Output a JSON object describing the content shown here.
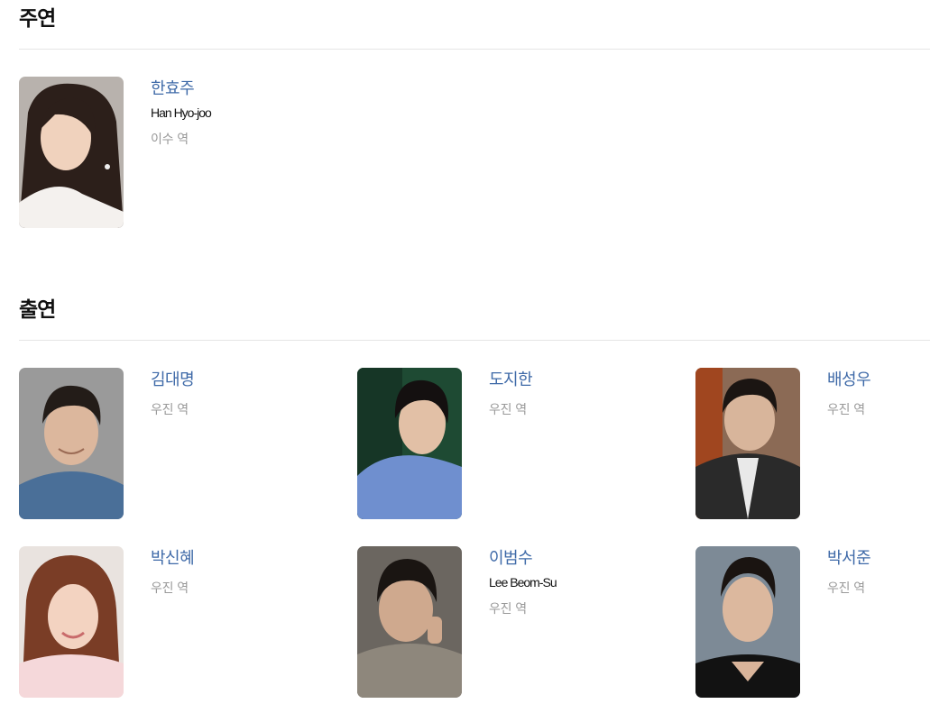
{
  "sections": {
    "lead": {
      "title": "주연",
      "cast": [
        {
          "name_ko": "한효주",
          "name_en": "Han Hyo-joo",
          "role": "이수 역",
          "photo": "portrait-han-hyo-joo"
        }
      ]
    },
    "supporting": {
      "title": "출연",
      "cast": [
        {
          "name_ko": "김대명",
          "role": "우진 역",
          "photo": "portrait-kim-dae-myung"
        },
        {
          "name_ko": "도지한",
          "role": "우진 역",
          "photo": "portrait-do-ji-han"
        },
        {
          "name_ko": "배성우",
          "role": "우진 역",
          "photo": "portrait-bae-sung-woo"
        },
        {
          "name_ko": "박신혜",
          "role": "우진 역",
          "photo": "portrait-park-shin-hye"
        },
        {
          "name_ko": "이범수",
          "name_en": "Lee Beom-Su",
          "role": "우진 역",
          "photo": "portrait-lee-beom-su"
        },
        {
          "name_ko": "박서준",
          "role": "우진 역",
          "photo": "portrait-park-seo-joon"
        }
      ]
    }
  },
  "colors": {
    "name_link": "#3f6aa8",
    "role_text": "#999999",
    "divider": "#e6e6e6"
  }
}
